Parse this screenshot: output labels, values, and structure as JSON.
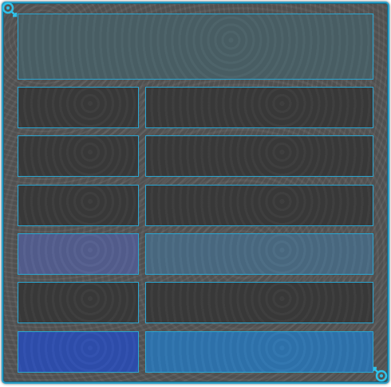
{
  "colors": {
    "frame_border": "#2a9fc8",
    "frame_fill": "#565656",
    "panel_border": "#2aa6d2",
    "header_fill": "#4a6066",
    "dark_fill": "#3a3a3a",
    "violet_fill": "#545e8e",
    "teal_fill": "#4a6a82",
    "blue_fill": "#2e4eae",
    "cyan_fill": "#2e74ae"
  },
  "icons": {
    "top_left": "hook-ornament-icon",
    "bottom_right": "hook-ornament-icon"
  },
  "header": {
    "text": ""
  },
  "rows": [
    {
      "left": "",
      "right": "",
      "style": "dark"
    },
    {
      "left": "",
      "right": "",
      "style": "dark"
    },
    {
      "left": "",
      "right": "",
      "style": "dark"
    },
    {
      "left": "",
      "right": "",
      "style": "highlight"
    },
    {
      "left": "",
      "right": "",
      "style": "dark"
    },
    {
      "left": "",
      "right": "",
      "style": "selected"
    }
  ]
}
